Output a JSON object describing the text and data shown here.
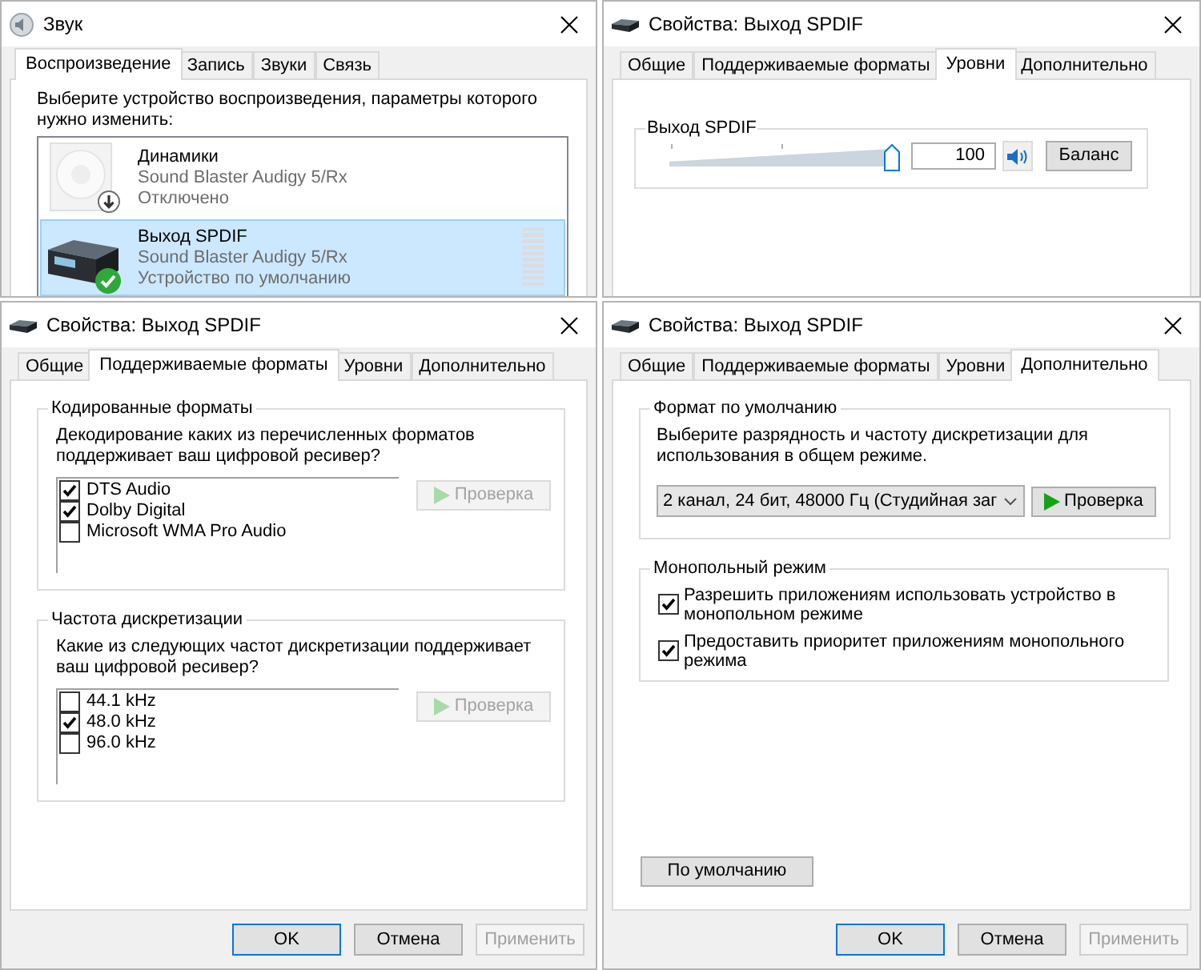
{
  "sound_window": {
    "title": "Звук",
    "tabs": [
      {
        "label": "Воспроизведение",
        "selected": true
      },
      {
        "label": "Запись",
        "selected": false
      },
      {
        "label": "Звуки",
        "selected": false
      },
      {
        "label": "Связь",
        "selected": false
      }
    ],
    "instruction": "Выберите устройство воспроизведения, параметры которого нужно изменить:",
    "devices": [
      {
        "kind": "speakers",
        "name": "Динамики",
        "driver": "Sound Blaster Audigy 5/Rx",
        "status": "Отключено",
        "disabled": true,
        "default": false,
        "selected": false
      },
      {
        "kind": "receiver",
        "name": "Выход SPDIF",
        "driver": "Sound Blaster Audigy 5/Rx",
        "status": "Устройство по умолчанию",
        "disabled": false,
        "default": true,
        "selected": true
      }
    ]
  },
  "levels_window": {
    "title": "Свойства: Выход SPDIF",
    "tabs": [
      {
        "label": "Общие",
        "selected": false
      },
      {
        "label": "Поддерживаемые форматы",
        "selected": false
      },
      {
        "label": "Уровни",
        "selected": true
      },
      {
        "label": "Дополнительно",
        "selected": false
      }
    ],
    "channel": {
      "label": "Выход SPDIF",
      "level": 1,
      "value": "100",
      "muted": false
    },
    "balance_button": "Баланс"
  },
  "formats_window": {
    "title": "Свойства: Выход SPDIF",
    "tabs": [
      {
        "label": "Общие",
        "selected": false
      },
      {
        "label": "Поддерживаемые форматы",
        "selected": true
      },
      {
        "label": "Уровни",
        "selected": false
      },
      {
        "label": "Дополнительно",
        "selected": false
      }
    ],
    "groups": [
      {
        "title": "Кодированные форматы",
        "prompt": "Декодирование каких из перечисленных форматов поддерживает ваш цифровой ресивер?",
        "options": [
          {
            "label": "DTS Audio",
            "checked": true
          },
          {
            "label": "Dolby Digital",
            "checked": true
          },
          {
            "label": "Microsoft WMA Pro Audio",
            "checked": false
          }
        ],
        "test_button": {
          "label": "Проверка",
          "disabled": true
        }
      },
      {
        "title": "Частота дискретизации",
        "prompt": "Какие из следующих частот дискретизации поддерживает ваш цифровой ресивер?",
        "options": [
          {
            "label": "44.1 kHz",
            "checked": false
          },
          {
            "label": "48.0 kHz",
            "checked": true
          },
          {
            "label": "96.0 kHz",
            "checked": false
          }
        ],
        "test_button": {
          "label": "Проверка",
          "disabled": true
        }
      }
    ],
    "buttons": [
      {
        "label": "OK",
        "default": true,
        "disabled": false
      },
      {
        "label": "Отмена",
        "default": false,
        "disabled": false
      },
      {
        "label": "Применить",
        "default": false,
        "disabled": true
      }
    ]
  },
  "advanced_window": {
    "title": "Свойства: Выход SPDIF",
    "tabs": [
      {
        "label": "Общие",
        "selected": false
      },
      {
        "label": "Поддерживаемые форматы",
        "selected": false
      },
      {
        "label": "Уровни",
        "selected": false
      },
      {
        "label": "Дополнительно",
        "selected": true
      }
    ],
    "default_format": {
      "title": "Формат по умолчанию",
      "prompt": "Выберите разрядность и частоту дискретизации для использования в общем режиме.",
      "value": "2 канал, 24 бит, 48000 Гц (Студийная заг",
      "test_button": {
        "label": "Проверка",
        "disabled": false
      }
    },
    "exclusive_mode": {
      "title": "Монопольный режим",
      "options": [
        {
          "label": "Разрешить приложениям использовать устройство в монопольном режиме",
          "checked": true
        },
        {
          "label": "Предоставить приоритет приложениям монопольного режима",
          "checked": true
        }
      ]
    },
    "restore_button": "По умолчанию",
    "buttons": [
      {
        "label": "OK",
        "default": true,
        "disabled": false
      },
      {
        "label": "Отмена",
        "default": false,
        "disabled": false
      },
      {
        "label": "Применить",
        "default": false,
        "disabled": true
      }
    ]
  }
}
